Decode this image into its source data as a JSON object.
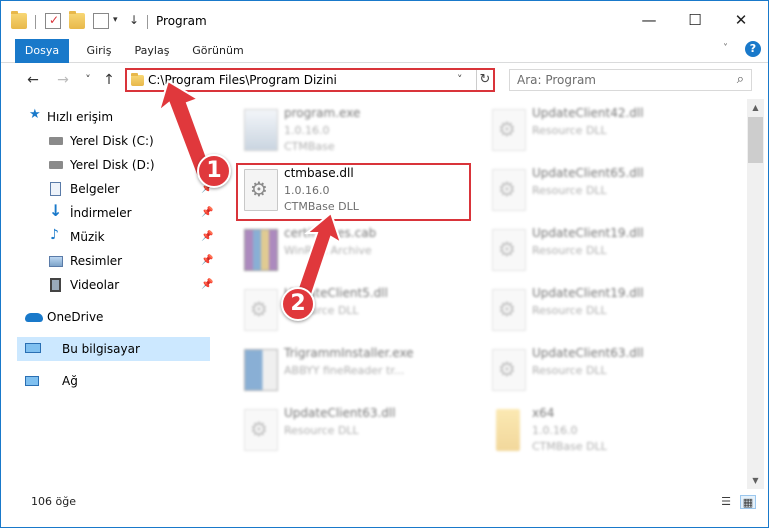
{
  "window": {
    "title": "Program",
    "controls": {
      "minimize": "—",
      "maximize": "☐",
      "close": "✕"
    }
  },
  "ribbon": {
    "tabs": [
      "Dosya",
      "Giriş",
      "Paylaş",
      "Görünüm"
    ],
    "help": "?"
  },
  "nav": {
    "back": "←",
    "forward": "→",
    "recent": "˅",
    "up": "↑",
    "address": "C:\\Program Files\\Program Dizini",
    "refresh": "↻",
    "dropdown": "˅",
    "search_placeholder": "Ara: Program",
    "search_icon": "⌕"
  },
  "sidebar": {
    "items": [
      {
        "label": "Hızlı erişim",
        "icon": "star-icon",
        "pinned": false
      },
      {
        "label": "Yerel Disk (C:)",
        "icon": "drive-icon",
        "pinned": true
      },
      {
        "label": "Yerel Disk (D:)",
        "icon": "drive-icon",
        "pinned": true
      },
      {
        "label": "Belgeler",
        "icon": "documents-icon",
        "pinned": true
      },
      {
        "label": "İndirmeler",
        "icon": "download-icon",
        "pinned": true
      },
      {
        "label": "Müzik",
        "icon": "music-icon",
        "pinned": true
      },
      {
        "label": "Resimler",
        "icon": "pictures-icon",
        "pinned": true
      },
      {
        "label": "Videolar",
        "icon": "videos-icon",
        "pinned": true
      },
      {
        "label": "OneDrive",
        "icon": "cloud-icon",
        "pinned": false
      },
      {
        "label": "Bu bilgisayar",
        "icon": "computer-icon",
        "pinned": false
      },
      {
        "label": "Ağ",
        "icon": "network-icon",
        "pinned": false
      }
    ],
    "pin_glyph": "📌"
  },
  "files": [
    {
      "name": "program.exe",
      "line2": "1.0.16.0",
      "line3": "CTMBase",
      "icon": "exe-icon",
      "blurred": true
    },
    {
      "name": "UpdateClient42.dll",
      "line2": "Resource DLL",
      "line3": "",
      "icon": "dll-icon",
      "blurred": true
    },
    {
      "name": "ctmbase.dll",
      "line2": "1.0.16.0",
      "line3": "CTMBase DLL",
      "icon": "dll-icon",
      "blurred": false
    },
    {
      "name": "UpdateClient65.dll",
      "line2": "Resource DLL",
      "line3": "",
      "icon": "dll-icon",
      "blurred": true
    },
    {
      "name": "certificates.cab",
      "line2": "WinRAR Archive",
      "line3": "",
      "icon": "archive-icon",
      "blurred": true
    },
    {
      "name": "UpdateClient19.dll",
      "line2": "Resource DLL",
      "line3": "",
      "icon": "dll-icon",
      "blurred": true
    },
    {
      "name": "UpdateClient5.dll",
      "line2": "Resource DLL",
      "line3": "",
      "icon": "dll-icon",
      "blurred": true
    },
    {
      "name": "UpdateClient19.dll",
      "line2": "Resource DLL",
      "line3": "",
      "icon": "dll-icon",
      "blurred": true
    },
    {
      "name": "TrigrammInstaller.exe",
      "line2": "ABBYY fineReader tr...",
      "line3": "",
      "icon": "installer-icon",
      "blurred": true
    },
    {
      "name": "UpdateClient63.dll",
      "line2": "Resource DLL",
      "line3": "",
      "icon": "dll-icon",
      "blurred": true
    },
    {
      "name": "UpdateClient63.dll",
      "line2": "Resource DLL",
      "line3": "",
      "icon": "dll-icon",
      "blurred": true
    },
    {
      "name": "x64",
      "line2": "1.0.16.0",
      "line3": "CTMBase DLL",
      "icon": "folder-icon",
      "blurred": true
    }
  ],
  "callouts": [
    "1",
    "2"
  ],
  "status": {
    "count": "106 öğe"
  },
  "colors": {
    "accent": "#1979ca",
    "highlight": "#d9343a",
    "selection": "#cce8ff"
  }
}
